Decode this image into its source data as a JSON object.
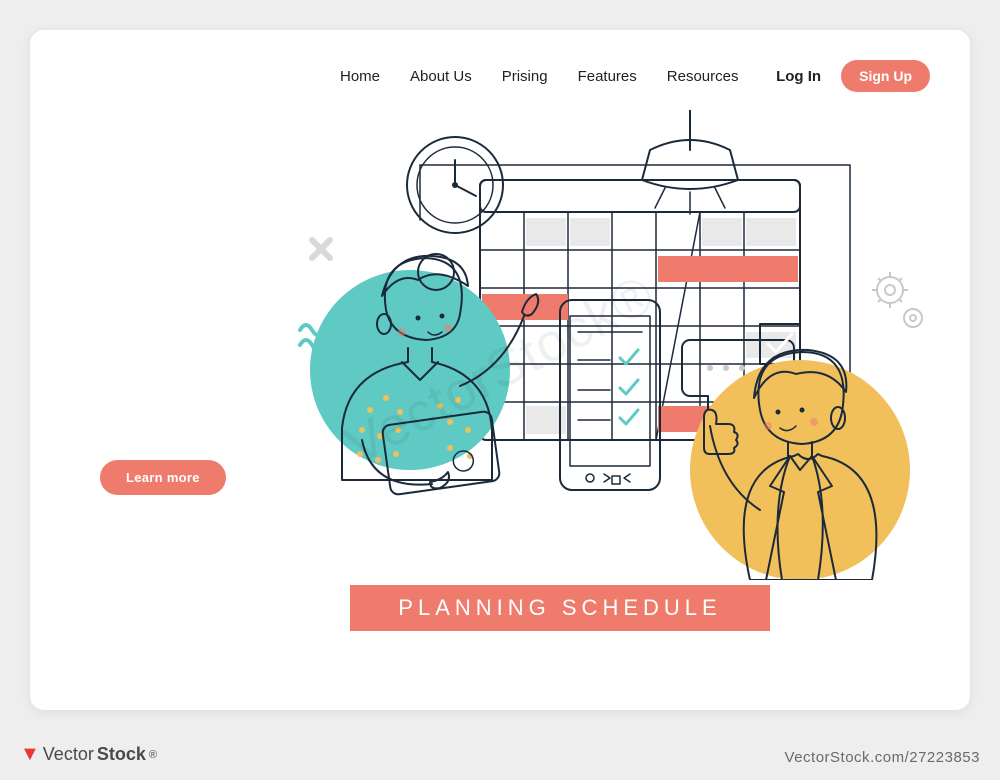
{
  "nav": {
    "items": [
      "Home",
      "About Us",
      "Prising",
      "Features",
      "Resources"
    ],
    "login": "Log In",
    "signup": "Sign Up"
  },
  "cta": {
    "learn_more": "Learn more"
  },
  "hero": {
    "title": "PLANNING SCHEDULE"
  },
  "stock": {
    "brand_a": "Vector",
    "brand_b": "Stock",
    "id": "27223853"
  },
  "watermark": "VectorStock®",
  "colors": {
    "accent": "#ee7b6c",
    "teal": "#5fc9c4",
    "mustard": "#f1c05b",
    "navy": "#2f3a6b",
    "skin": "#fbe0d2",
    "hair_orange": "#e88e3f"
  }
}
